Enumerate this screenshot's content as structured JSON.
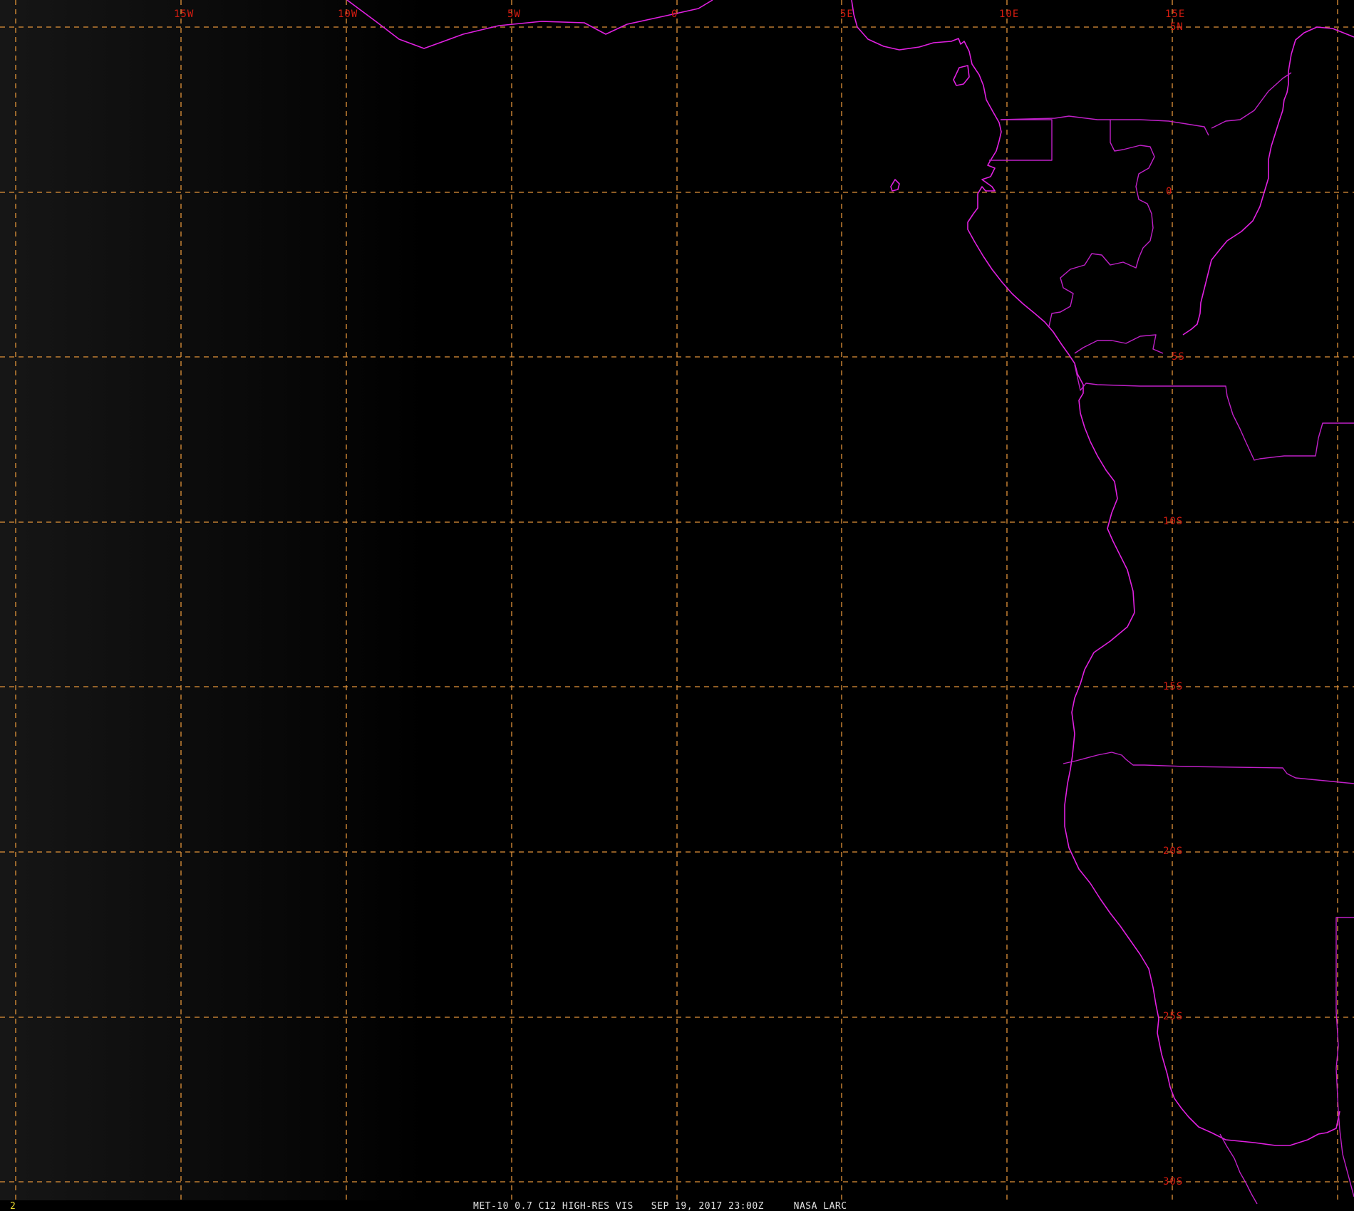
{
  "map": {
    "longitude_labels": [
      "15W",
      "10W",
      "5W",
      "0",
      "5E",
      "10E",
      "15E"
    ],
    "latitude_labels": [
      "5N",
      "0",
      "5S",
      "10S",
      "15S",
      "20S",
      "25S",
      "30S"
    ],
    "frame_number": "2",
    "caption": "MET-10 0.7 C12 HIGH-RES VIS   SEP 19, 2017 23:00Z     NASA LARC"
  },
  "colors": {
    "background": "#000000",
    "graticule": "#e3943a",
    "graticule_labels": "#d41c10",
    "coastlines": "#e020e0",
    "caption": "#e0e0e0",
    "frame_number": "#e8d830"
  }
}
